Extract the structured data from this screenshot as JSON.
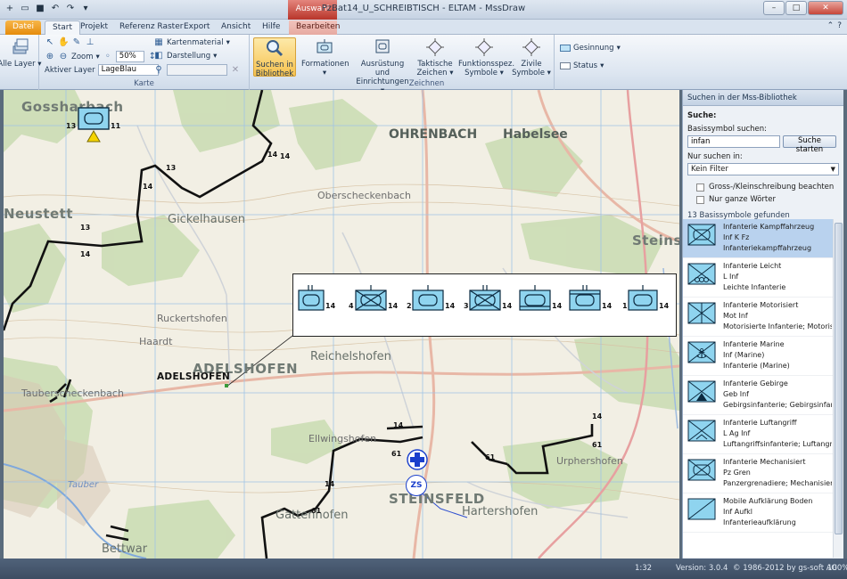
{
  "window": {
    "title": "PzBat14_U_SCHREIBTISCH - ELTAM - MssDraw",
    "context_tab": "Auswahl"
  },
  "tabs": [
    "Datei",
    "Start",
    "Projekt",
    "Referenz Raster",
    "Export",
    "Ansicht",
    "Hilfe",
    "Bearbeiten"
  ],
  "ribbon": {
    "layers": {
      "label": "Alle Layer"
    },
    "karte": {
      "zoom_label": "Zoom",
      "zoom_value": "50%",
      "aktiver_layer_label": "Aktiver Layer",
      "aktiver_layer_value": "LageBlau",
      "kartenmaterial": "Kartenmaterial",
      "darstellung": "Darstellung",
      "group_label": "Karte"
    },
    "search_button": "Suchen in Bibliothek",
    "zeichnen": {
      "formationen": "Formationen",
      "ausruestung": "Ausrüstung und Einrichtungen",
      "taktische": "Taktische Zeichen",
      "funktion": "Funktionsspez. Symbole",
      "zivile": "Zivile Symbole",
      "group_label": "Zeichnen"
    },
    "gesinnung": "Gesinnung",
    "status": "Status"
  },
  "map": {
    "places": [
      {
        "text": "Gossharbach",
        "cls": "big"
      },
      {
        "text": "OHRENBACH",
        "cls": "dark"
      },
      {
        "text": "Habelsee",
        "cls": "dark"
      },
      {
        "text": "Oberscheckenbach",
        "cls": "sm"
      },
      {
        "text": "Neustett",
        "cls": "big"
      },
      {
        "text": "Gickelhausen",
        "cls": "mid"
      },
      {
        "text": "Steins",
        "cls": "big"
      },
      {
        "text": "Ruckertshofen",
        "cls": "sm"
      },
      {
        "text": "Haardt",
        "cls": "sm"
      },
      {
        "text": "Reichelshofen",
        "cls": "mid"
      },
      {
        "text": "ADELSHOFEN",
        "cls": "big"
      },
      {
        "text": "Tauberscheckenbach",
        "cls": "sm"
      },
      {
        "text": "Ellwingshofen",
        "cls": "sm"
      },
      {
        "text": "Urphershofen",
        "cls": "sm"
      },
      {
        "text": "Tauber",
        "cls": "river"
      },
      {
        "text": "STEINSFELD",
        "cls": "big"
      },
      {
        "text": "Hartershofen",
        "cls": "mid"
      },
      {
        "text": "Gattenhofen",
        "cls": "mid"
      },
      {
        "text": "Bettwar",
        "cls": "mid"
      }
    ],
    "adelshofen_label": "ADELSHOFEN",
    "symbol_box_nums": [
      "14",
      "4",
      "14",
      "2",
      "14",
      "3",
      "14",
      "14",
      "14",
      "1",
      "14"
    ],
    "unit_labels": {
      "top_left_a": "13",
      "top_left_b": "11",
      "b1": "13",
      "b2": "14",
      "b3": "13",
      "b4": "14",
      "b5": "14",
      "b6": "14",
      "b7": "14",
      "b8": "61",
      "b9": "14",
      "b10": "61",
      "b11": "61",
      "b12": "14",
      "b13": "61"
    },
    "zs_label": "ZS"
  },
  "panel": {
    "header": "Suchen in der Mss-Bibliothek",
    "section": "Suche:",
    "basis_label": "Basissymbol suchen:",
    "search_value": "infan",
    "search_button": "Suche starten",
    "scope_label": "Nur suchen in:",
    "scope_value": "Kein Filter",
    "chk_case": "Gross-/Kleinschreibung beachten",
    "chk_words": "Nur ganze Wörter",
    "count": "13 Basissymbole gefunden",
    "results": [
      {
        "name": "Infanterie Kampffahrzeug",
        "abbr": "Inf K Fz",
        "desc": "Infanteriekampffahrzeug",
        "sym": "ifv"
      },
      {
        "name": "Infanterie Leicht",
        "abbr": "L Inf",
        "desc": "Leichte Infanterie",
        "sym": "light"
      },
      {
        "name": "Infanterie Motorisiert",
        "abbr": "Mot Inf",
        "desc": "Motorisierte Infanterie; Motorisierte Infanterie",
        "sym": "mot"
      },
      {
        "name": "Infanterie Marine",
        "abbr": "Inf (Marine)",
        "desc": "Infanterie (Marine)",
        "sym": "marine"
      },
      {
        "name": "Infanterie Gebirge",
        "abbr": "Geb Inf",
        "desc": "Gebirgsinfanterie; Gebirgsinfanterie",
        "sym": "mountain"
      },
      {
        "name": "Infanterie Luftangriff",
        "abbr": "L Ag Inf",
        "desc": "Luftangriffsinfanterie; Luftangriffsinfanterie",
        "sym": "air"
      },
      {
        "name": "Infanterie Mechanisiert",
        "abbr": "Pz Gren",
        "desc": "Panzergrenadiere; Mechanisierte Infanterie",
        "sym": "mech"
      },
      {
        "name": "Mobile Aufklärung Boden",
        "abbr": "Inf Aufkl",
        "desc": "Infanterieaufklärung",
        "sym": "recon"
      }
    ]
  },
  "status": {
    "scale": "1:32",
    "version": "Version: 3.0.4",
    "copyright": "© 1986-2012 by gs-soft AG",
    "zoom": "100%"
  }
}
